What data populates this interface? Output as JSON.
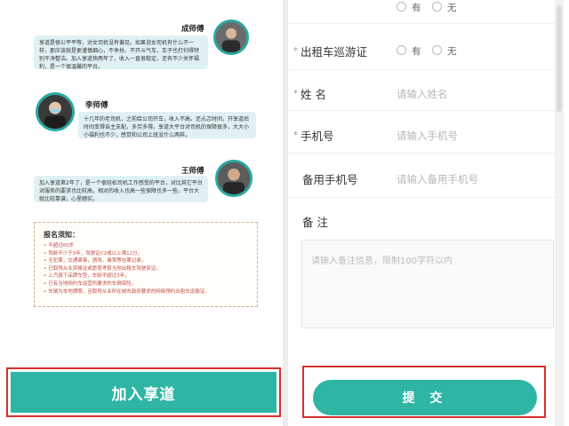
{
  "testimonials": [
    {
      "name": "成师傅",
      "text": "享道是很公平平等，对女司机没有偏见。如果说女司机有什么不一样，那应该就是更谨慎细心，不争抢、不开斗气车，车子也打扫得特别干净整洁。加入享道快两年了，收入一直很稳定，还有不少关怀福利，是一个很温馨的平台。"
    },
    {
      "name": "李师傅",
      "text": "十几年的老司机，之前给公司开车，收入不高。还忐忑时间，开享道后时间变得自主支配，多劳多得。享道大平台对司机的保障很多，大大小小福利也不少，感觉和公司上班没什么两样。"
    },
    {
      "name": "王师傅",
      "text": "加入享道第2年了，是一个很轻松司机工作感受的平台，对比其它平台对服务的要求也比较高，相对的收入也高一些保障也多一些。平台大就比较靠谱，心里踏实。"
    }
  ],
  "notice": {
    "title": "报名须知：",
    "items": [
      "不超过60岁",
      "驾龄不少于3年，驾驶证C2或以上满12分。",
      "无犯罪，交通肇事，酒驾，毒驾等在案记录。",
      "已取得从业资格证或愿意考取当地出租车驾驶资证。",
      "上汽旗下品牌车型，车龄不超过3年。",
      "已有当地网约车运营所要求的车辆保险。",
      "车辆为本地牌照，且取得从业所在城市政府要求的网络预约出租车运输证。"
    ]
  },
  "join_button": "加入享道",
  "form": {
    "top_options": [
      "有",
      "无"
    ],
    "cruise_label": "出租车巡游证",
    "cruise_options": [
      "有",
      "无"
    ],
    "name_label": "姓 名",
    "name_placeholder": "请输入姓名",
    "phone_label": "手机号",
    "phone_placeholder": "请输入手机号",
    "backup_label": "备用手机号",
    "backup_placeholder": "请输入备用手机号",
    "remark_label": "备 注",
    "remark_placeholder": "请输入备注信息，限制100字符以内",
    "required_mark": "*",
    "submit_label": "提 交"
  },
  "colors": {
    "accent": "#2fb5a4",
    "highlight_border": "#d9302c",
    "bubble_bg": "#dff1f3",
    "notice_text": "#c05050"
  }
}
